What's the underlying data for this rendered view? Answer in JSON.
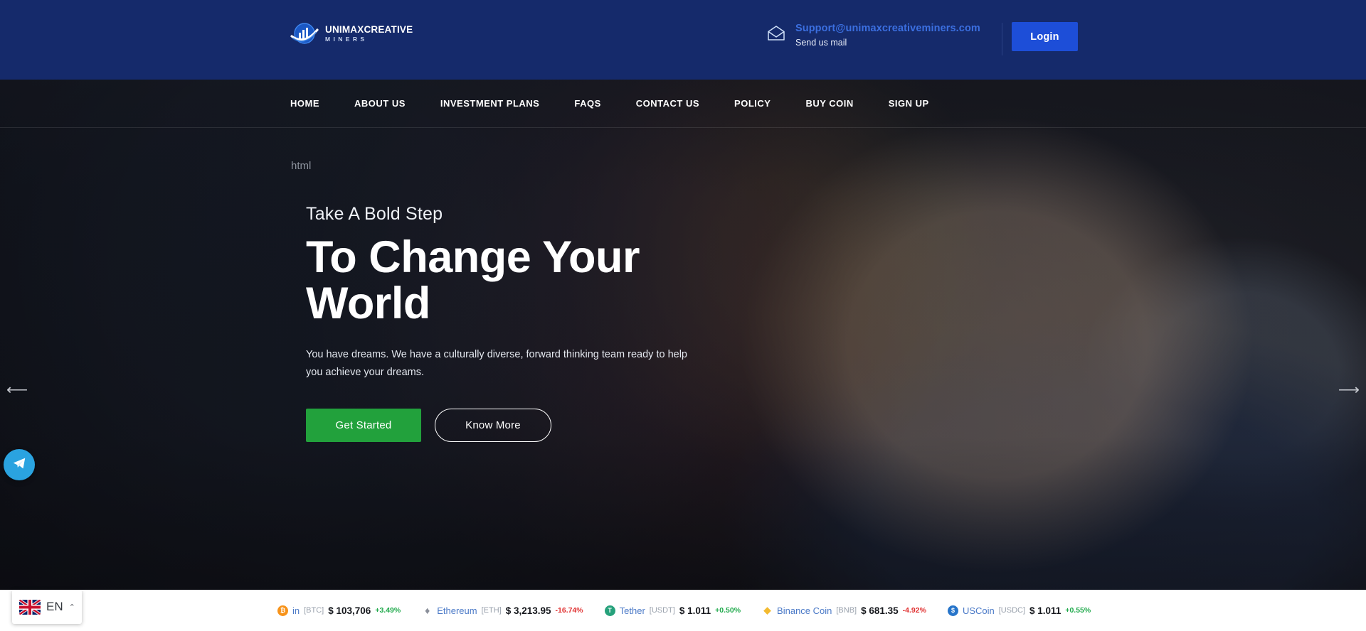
{
  "brand": {
    "logo_title": "UNIMAXCREATIVE",
    "logo_subtitle": "MINERS",
    "logo_icon": "globe-chart-icon"
  },
  "header": {
    "mail_icon": "envelope-icon",
    "email": "Support@unimaxcreativeminers.com",
    "email_caption": "Send us mail",
    "login_label": "Login",
    "login_color": "#1d4ed8",
    "bar_color": "#152a6b"
  },
  "nav": {
    "items": [
      {
        "label": "HOME"
      },
      {
        "label": "ABOUT US"
      },
      {
        "label": "INVESTMENT PLANS"
      },
      {
        "label": "FAQS"
      },
      {
        "label": "CONTACT US"
      },
      {
        "label": "POLICY"
      },
      {
        "label": "BUY COIN"
      },
      {
        "label": "SIGN UP"
      }
    ],
    "artifact_text": "html"
  },
  "hero": {
    "eyebrow": "Take A Bold Step",
    "headline_line1": "To Change Your",
    "headline_line2": "World",
    "paragraph": "You have dreams. We have a culturally diverse, forward thinking team ready to help you achieve your dreams.",
    "primary_cta": "Get Started",
    "secondary_cta": "Know More",
    "primary_cta_color": "#22a13c",
    "prev_arrow": "⟵",
    "next_arrow": "⟶"
  },
  "ticker": {
    "coins": [
      {
        "name": "in",
        "symbol": "[BTC]",
        "price": "$ 103,706",
        "change": "+3.49%",
        "direction": "up",
        "icon": "bitcoin-icon",
        "icon_color": "#f7931a",
        "icon_glyph": "₿"
      },
      {
        "name": "Ethereum",
        "symbol": "[ETH]",
        "price": "$ 3,213.95",
        "change": "-16.74%",
        "direction": "down",
        "icon": "ethereum-icon",
        "icon_color": "#8a8f9a",
        "icon_glyph": "♦"
      },
      {
        "name": "Tether",
        "symbol": "[USDT]",
        "price": "$ 1.011",
        "change": "+0.50%",
        "direction": "up",
        "icon": "tether-icon",
        "icon_color": "#26a17b",
        "icon_glyph": "T"
      },
      {
        "name": "Binance Coin",
        "symbol": "[BNB]",
        "price": "$ 681.35",
        "change": "-4.92%",
        "direction": "down",
        "icon": "binance-icon",
        "icon_color": "#f3ba2f",
        "icon_glyph": "◆"
      },
      {
        "name": "USCoin",
        "symbol": "[USDC]",
        "price": "$ 1.011",
        "change": "+0.55%",
        "direction": "up",
        "icon": "usdcoin-icon",
        "icon_color": "#2775ca",
        "icon_glyph": "$"
      }
    ]
  },
  "widgets": {
    "telegram_icon": "telegram-icon",
    "telegram_color": "#2aa3e0",
    "language_code": "EN",
    "language_flag": "uk-flag-icon",
    "language_chevron": "⌃"
  }
}
